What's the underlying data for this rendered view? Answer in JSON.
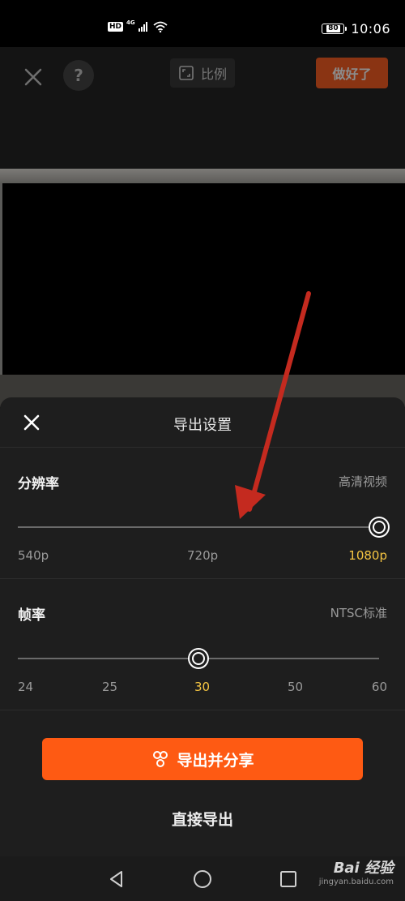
{
  "status_bar": {
    "network_badge": "HD",
    "network_type": "4G",
    "battery_level": "80",
    "time": "10:06",
    "icons": [
      "hd-badge-icon",
      "signal-icon",
      "wifi-icon",
      "battery-icon"
    ]
  },
  "toolbar": {
    "help_label": "?",
    "ratio_label": "比例",
    "done_label": "做好了",
    "icons": [
      "close-icon",
      "help-icon",
      "aspect-ratio-icon"
    ]
  },
  "export_sheet": {
    "title": "导出设置",
    "resolution": {
      "label": "分辨率",
      "hint": "高清视频",
      "options": [
        "540p",
        "720p",
        "1080p"
      ],
      "selected": "1080p",
      "selected_index": 2
    },
    "frame_rate": {
      "label": "帧率",
      "hint": "NTSC标准",
      "options": [
        "24",
        "25",
        "30",
        "50",
        "60"
      ],
      "selected": "30",
      "selected_index": 2
    },
    "export_share_label": "导出并分享",
    "export_direct_label": "直接导出",
    "icons": [
      "close-icon",
      "share-cluster-icon"
    ]
  },
  "navbar": {
    "icons": [
      "back-triangle-icon",
      "home-circle-icon",
      "recents-square-icon"
    ]
  },
  "watermark": {
    "main": "Bai 经验",
    "sub": "jingyan.baidu.com"
  },
  "colors": {
    "accent": "#fe5a13",
    "active_tick": "#f5c542",
    "annotation_arrow": "#c42a1f",
    "sheet_bg": "#1e1e1e"
  }
}
